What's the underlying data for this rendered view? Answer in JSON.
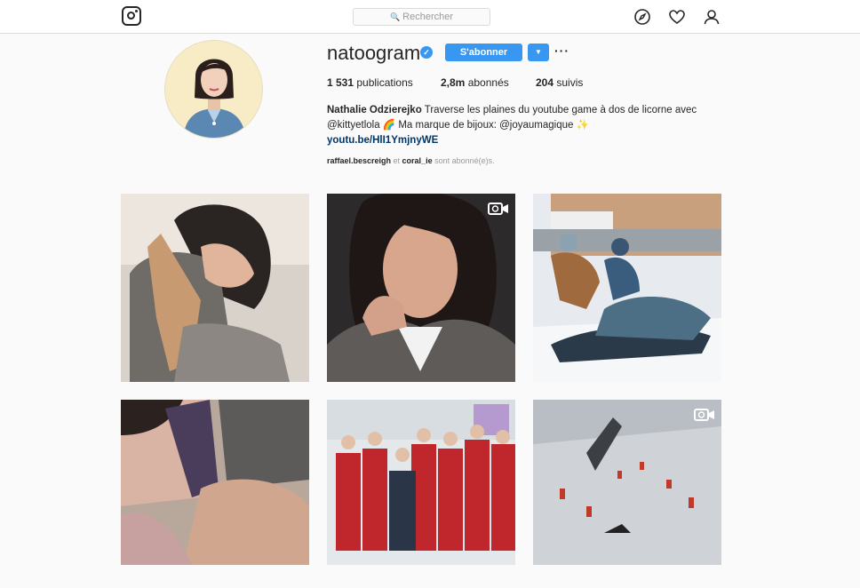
{
  "header": {
    "search_placeholder": "Rechercher",
    "search_icon": "magnifier-icon",
    "nav_icons": [
      "compass-icon",
      "heart-icon",
      "user-icon"
    ]
  },
  "profile": {
    "username": "natoogram",
    "verified": true,
    "follow_label": "S'abonner",
    "dropdown_icon": "caret-down-icon",
    "more_icon": "ellipsis-icon",
    "stats": {
      "posts_count": "1 531",
      "posts_label": " publications",
      "followers_count": "2,8m",
      "followers_label": " abonnés",
      "following_count": "204",
      "following_label": " suivis"
    },
    "bio": {
      "name": "Nathalie Odzierejko",
      "line1": " Traverse les plaines du youtube game à dos de licorne avec",
      "line2": "@kittyetlola 🌈 Ma marque de bijoux: @joyaumagique ✨",
      "link": "youtu.be/HlI1YmjnyWE"
    },
    "followed_by": {
      "user1": "raffael.bescreigh",
      "connector": " et ",
      "user2": "coral_ie",
      "suffix": " sont abonné(e)s."
    }
  },
  "posts": [
    {
      "label": "post-1",
      "video": false
    },
    {
      "label": "post-2",
      "video": true
    },
    {
      "label": "post-3",
      "video": false
    },
    {
      "label": "post-4",
      "video": false
    },
    {
      "label": "post-5",
      "video": false
    },
    {
      "label": "post-6",
      "video": true
    }
  ],
  "colors": {
    "accent": "#3897f0",
    "link": "#003569",
    "background": "#fafafa"
  }
}
